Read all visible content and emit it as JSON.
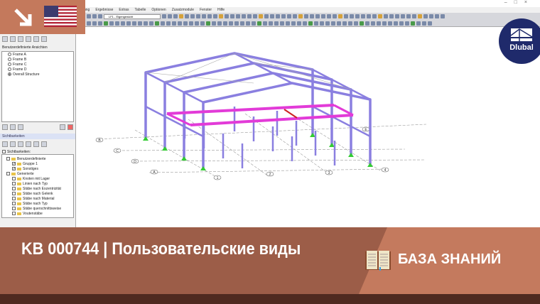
{
  "menu": [
    "ung",
    "Ergebnisse",
    "Extras",
    "Tabelle",
    "Optionen",
    "Zusatzmodule",
    "Fenster",
    "Hilfe"
  ],
  "toolbar": {
    "loadcase": "LF1 - Eigengewicht"
  },
  "window_controls": [
    "–",
    "□",
    "×"
  ],
  "left_panel": {
    "views_title": "Benutzerdefinierte Ansichten",
    "views": [
      {
        "label": "Frame A",
        "selected": false
      },
      {
        "label": "Frame B",
        "selected": false
      },
      {
        "label": "Frame C",
        "selected": false
      },
      {
        "label": "Frame D",
        "selected": false
      },
      {
        "label": "Overall Structure",
        "selected": true
      }
    ],
    "visibility_title": "Sichtbarkeiten",
    "visibility_checkbox": "Sichtbarkeiten:",
    "tree": [
      {
        "label": "Benutzerdefinierte",
        "level": 0,
        "checked": null
      },
      {
        "label": "Gruppe 1",
        "level": 1,
        "checked": true
      },
      {
        "label": "Sonstiges",
        "level": 1,
        "checked": true
      },
      {
        "label": "Generierte",
        "level": 0,
        "checked": null
      },
      {
        "label": "Knoten mit Lager",
        "level": 1,
        "checked": false
      },
      {
        "label": "Linien nach Typ",
        "level": 1,
        "checked": false
      },
      {
        "label": "Stäbe nach Exzentrizität",
        "level": 1,
        "checked": false
      },
      {
        "label": "Stäbe nach Gelenk",
        "level": 1,
        "checked": false
      },
      {
        "label": "Stäbe nach Material",
        "level": 1,
        "checked": false
      },
      {
        "label": "Stäbe nach Typ",
        "level": 1,
        "checked": false
      },
      {
        "label": "Stäbe querschnittsweise",
        "level": 1,
        "checked": false
      },
      {
        "label": "Voutenstäbe",
        "level": 1,
        "checked": false
      }
    ]
  },
  "grid_labels": {
    "letters": [
      "A",
      "B",
      "C",
      "D",
      "E"
    ],
    "numbers": [
      "1",
      "2",
      "3",
      "4"
    ]
  },
  "banner": {
    "title": "KB 000744 | Пользовательские виды",
    "category": "БАЗА ЗНАНИЙ"
  },
  "logo": "Dlubal",
  "colors": {
    "banner": "#9c5d48",
    "banner_accent": "#c47a5e",
    "bottom": "#4f2a20",
    "members": "#8a7fe0",
    "highlight": "#e23bd8",
    "logo": "#1f2a6b"
  }
}
